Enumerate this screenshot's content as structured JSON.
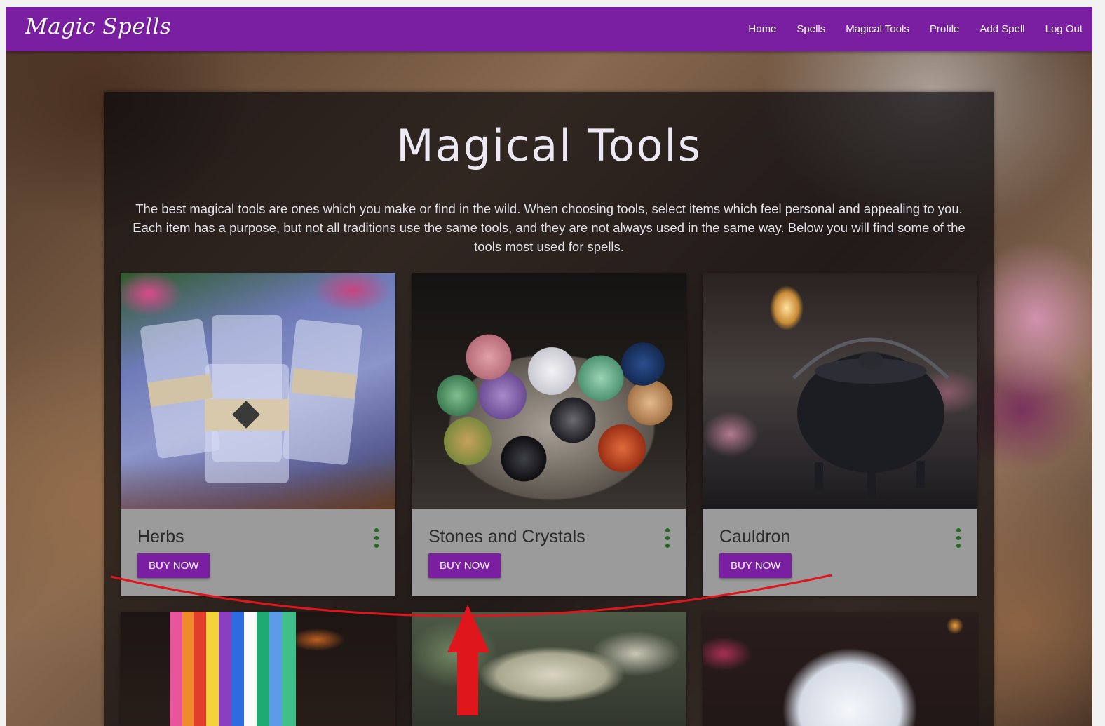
{
  "navbar": {
    "brand": "Magic Spells",
    "links": [
      "Home",
      "Spells",
      "Magical Tools",
      "Profile",
      "Add Spell",
      "Log Out"
    ]
  },
  "main": {
    "title": "Magical Tools",
    "intro": "The best magical tools are ones which you make or find in the wild. When choosing tools, select items which feel personal and appealing to you. Each item has a purpose, but not all traditions use the same tools, and they are not always used in the same way. Below you will find some of the tools most used for spells.",
    "cards": [
      {
        "title": "Herbs",
        "button": "Buy Now",
        "image": "herbs-photo"
      },
      {
        "title": "Stones and Crystals",
        "button": "Buy Now",
        "image": "stones-photo"
      },
      {
        "title": "Cauldron",
        "button": "Buy Now",
        "image": "cauldron-photo"
      }
    ],
    "next_row_images": [
      "candles-photo",
      "sage-bundles-photo",
      "salt-photo"
    ]
  },
  "colors": {
    "brand": "#7b1fa2",
    "menu_icon": "#1b6b1b",
    "annotation": "#e0161d"
  },
  "icons": {
    "card_menu": "kebab-vertical-icon"
  }
}
